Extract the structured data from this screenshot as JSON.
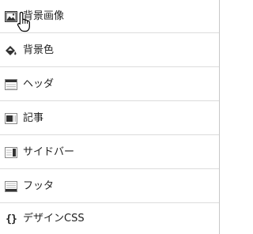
{
  "menu": {
    "items": [
      {
        "label": "背景画像",
        "icon": "image-icon"
      },
      {
        "label": "背景色",
        "icon": "paint-bucket-icon"
      },
      {
        "label": "ヘッダ",
        "icon": "header-layout-icon"
      },
      {
        "label": "記事",
        "icon": "article-layout-icon"
      },
      {
        "label": "サイドバー",
        "icon": "sidebar-layout-icon"
      },
      {
        "label": "フッタ",
        "icon": "footer-layout-icon"
      },
      {
        "label": "デザインCSS",
        "icon": "css-braces-icon",
        "glyph": "{}"
      }
    ]
  },
  "colors": {
    "text": "#222222",
    "divider": "#dcdcdc",
    "icon_dark": "#333333",
    "icon_frame": "#888888",
    "icon_fill": "#ffffff"
  }
}
